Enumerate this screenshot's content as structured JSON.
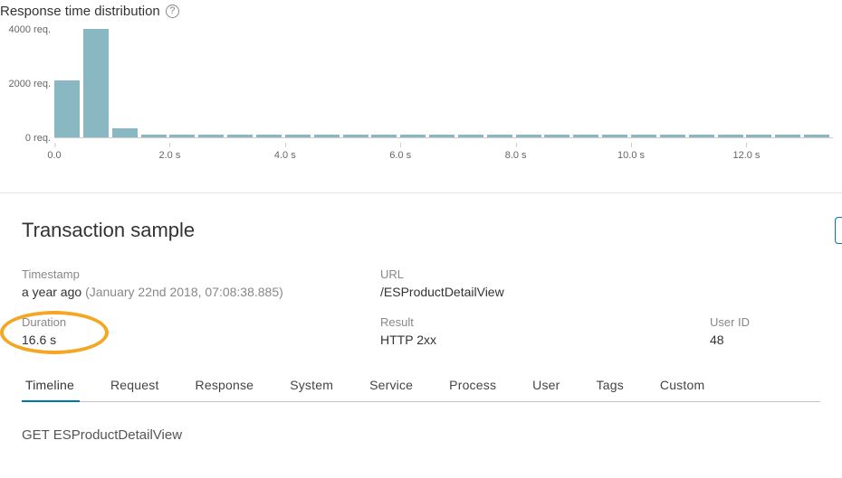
{
  "header": {
    "title": "Response time distribution",
    "help_icon": "?"
  },
  "chart_data": {
    "type": "bar",
    "xlabel": "",
    "ylabel": "",
    "x_unit": "s",
    "y_unit": "req.",
    "y_ticks": [
      0,
      2000,
      4000
    ],
    "y_tick_labels": [
      "0 req.",
      "2000 req.",
      "4000 req."
    ],
    "x_ticks": [
      0.0,
      2.0,
      4.0,
      6.0,
      8.0,
      10.0,
      12.0
    ],
    "x_tick_labels": [
      "0.0",
      "2.0 s",
      "4.0 s",
      "6.0 s",
      "8.0 s",
      "10.0 s",
      "12.0 s"
    ],
    "x_range": [
      0.0,
      13.5
    ],
    "ylim": [
      0,
      4000
    ],
    "bin_width": 0.5,
    "categories": [
      0.0,
      0.5,
      1.0,
      1.5,
      2.0,
      2.5,
      3.0,
      3.5,
      4.0,
      4.5,
      5.0,
      5.5,
      6.0,
      6.5,
      7.0,
      7.5,
      8.0,
      8.5,
      9.0,
      9.5,
      10.0,
      10.5,
      11.0,
      11.5,
      12.0,
      12.5,
      13.0
    ],
    "values": [
      2100,
      4000,
      350,
      80,
      40,
      40,
      40,
      40,
      40,
      40,
      40,
      40,
      40,
      40,
      40,
      40,
      40,
      40,
      40,
      40,
      40,
      40,
      40,
      40,
      40,
      40,
      40
    ]
  },
  "sample": {
    "heading": "Transaction sample",
    "fields": {
      "timestamp_label": "Timestamp",
      "timestamp_value_main": "a year ago",
      "timestamp_value_sub": "(January 22nd 2018, 07:08:38.885)",
      "url_label": "URL",
      "url_value": "/ESProductDetailView",
      "duration_label": "Duration",
      "duration_value": "16.6 s",
      "result_label": "Result",
      "result_value": "HTTP 2xx",
      "userid_label": "User ID",
      "userid_value": "48"
    }
  },
  "tabs": [
    "Timeline",
    "Request",
    "Response",
    "System",
    "Service",
    "Process",
    "User",
    "Tags",
    "Custom"
  ],
  "active_tab": "Timeline",
  "timeline": {
    "title": "GET ESProductDetailView"
  },
  "annotation": {
    "highlight_field": "duration",
    "color": "#f5a623"
  }
}
